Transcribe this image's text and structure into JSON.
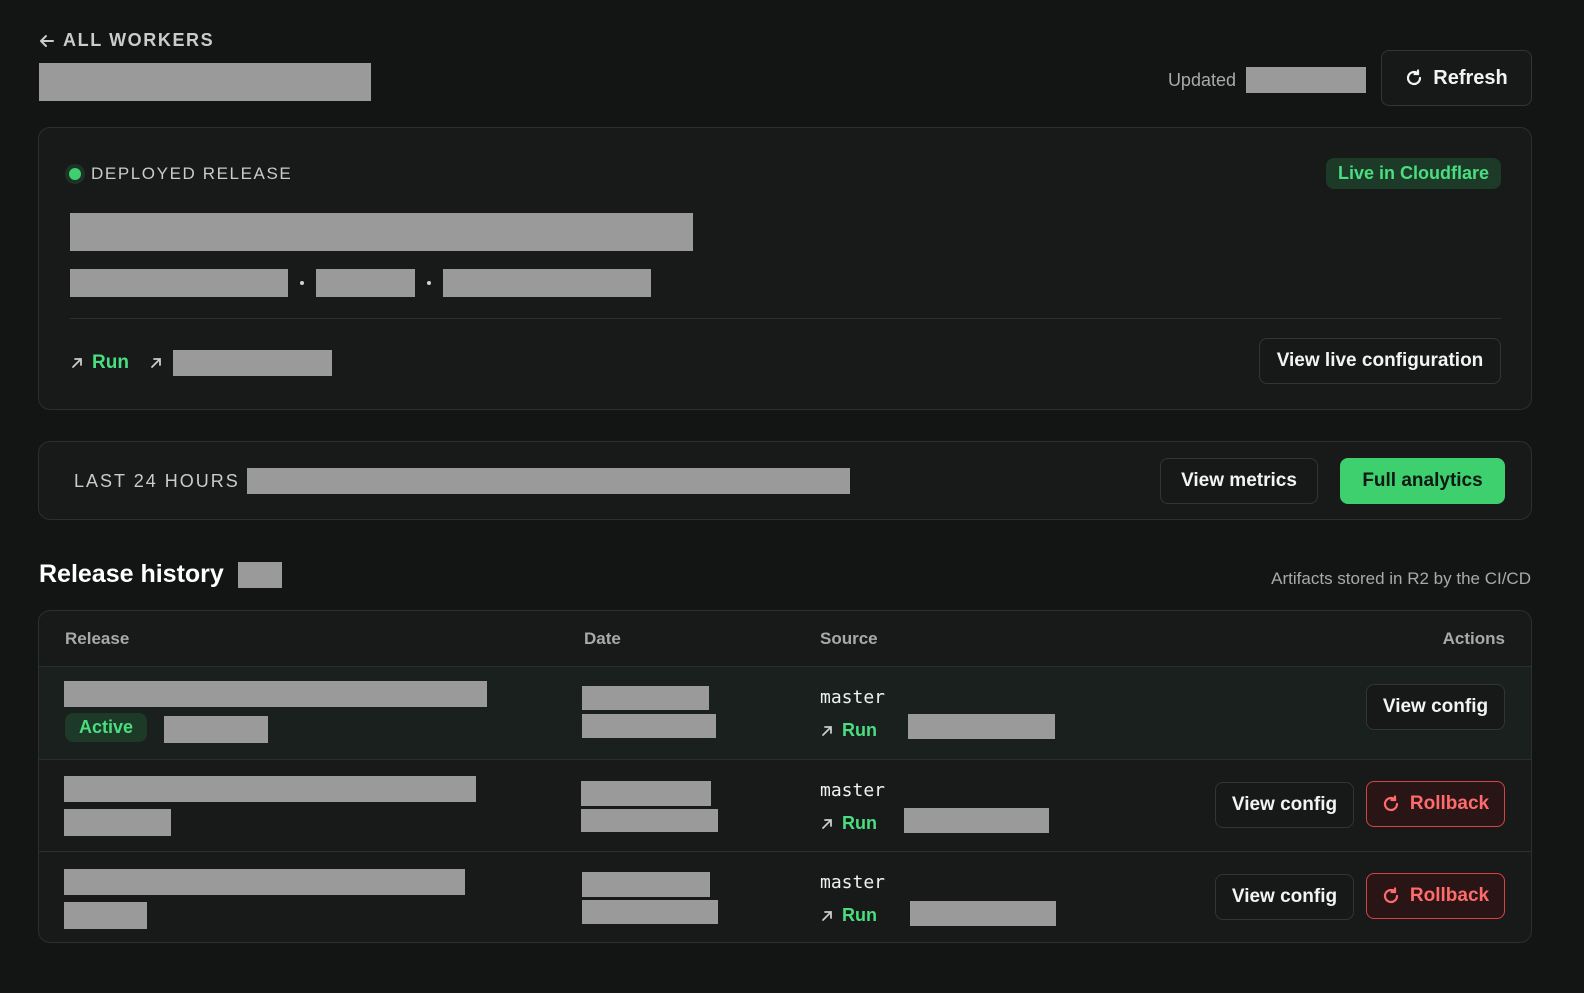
{
  "header": {
    "back_label": "ALL WORKERS",
    "updated_label": "Updated",
    "refresh_label": "Refresh"
  },
  "deployed": {
    "label": "DEPLOYED RELEASE",
    "badge": "Live in Cloudflare",
    "run_label": "Run",
    "view_config_label": "View live configuration"
  },
  "last24": {
    "label": "LAST 24 HOURS",
    "metrics_label": "View metrics",
    "analytics_label": "Full analytics"
  },
  "history": {
    "title": "Release history",
    "note": "Artifacts stored in R2 by the CI/CD",
    "columns": [
      "Release",
      "Date",
      "Source",
      "Actions"
    ],
    "rows": [
      {
        "status": "Active",
        "branch": "master",
        "run_label": "Run",
        "view_config": "View config"
      },
      {
        "branch": "master",
        "run_label": "Run",
        "view_config": "View config",
        "rollback": "Rollback"
      },
      {
        "branch": "master",
        "run_label": "Run",
        "view_config": "View config",
        "rollback": "Rollback"
      }
    ]
  },
  "colors": {
    "accent": "#3ecf6e",
    "danger": "#ff6b6b",
    "background": "#131514",
    "card": "#171a19"
  }
}
